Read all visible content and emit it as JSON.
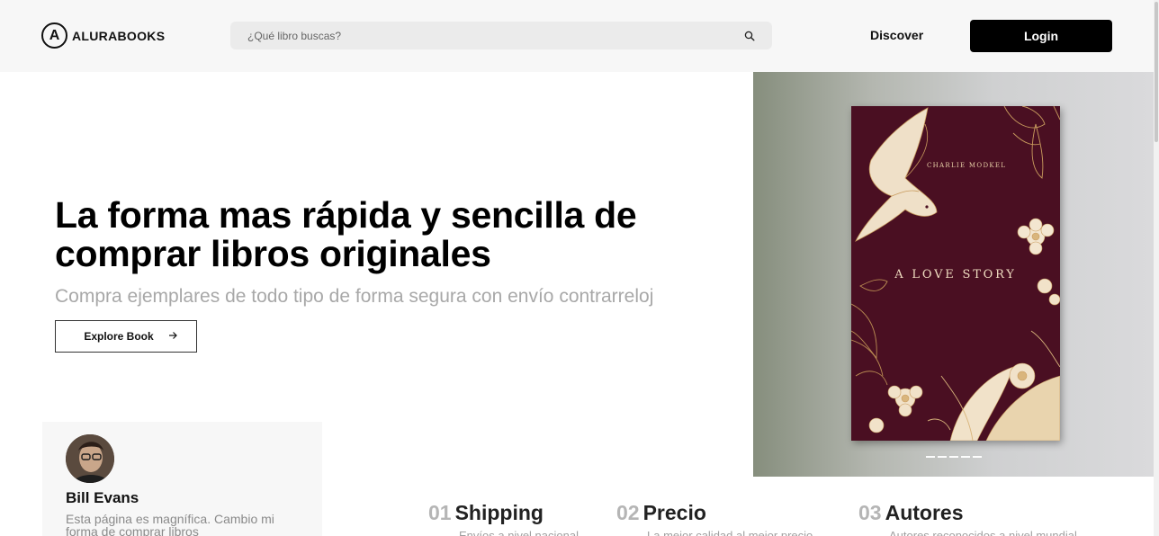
{
  "header": {
    "logo_letter": "A",
    "logo_text": "ALURABOOKS",
    "search_placeholder": "¿Qué libro buscas?",
    "search_value": "",
    "discover_label": "Discover",
    "login_label": "Login"
  },
  "hero": {
    "title": "La forma mas rápida y sencilla de comprar libros originales",
    "subtitle": "Compra ejemplares de todo tipo de forma segura con envío contrarreloj",
    "explore_label": "Explore Book"
  },
  "showcase": {
    "book_author": "CHARLIE MODKEL",
    "book_title": "A LOVE STORY",
    "carousel_dots": 5
  },
  "testimonial": {
    "name": "Bill Evans",
    "text": "Esta página es magnífica. Cambio mi forma de comprar libros"
  },
  "features": [
    {
      "number": "01",
      "title": "Shipping",
      "description": "Envíos a nivel nacional"
    },
    {
      "number": "02",
      "title": "Precio",
      "description": "La mejor calidad al mejor precio"
    },
    {
      "number": "03",
      "title": "Autores",
      "description": "Autores reconocidos a nivel mundial"
    }
  ],
  "colors": {
    "header_bg": "#f7f7f7",
    "search_bg": "#ebebeb",
    "login_bg": "#000000",
    "book_cover": "#4a0f22",
    "gold_accent": "#d9b57c"
  },
  "icons": {
    "search": "search-icon",
    "arrow": "arrow-right-icon"
  }
}
